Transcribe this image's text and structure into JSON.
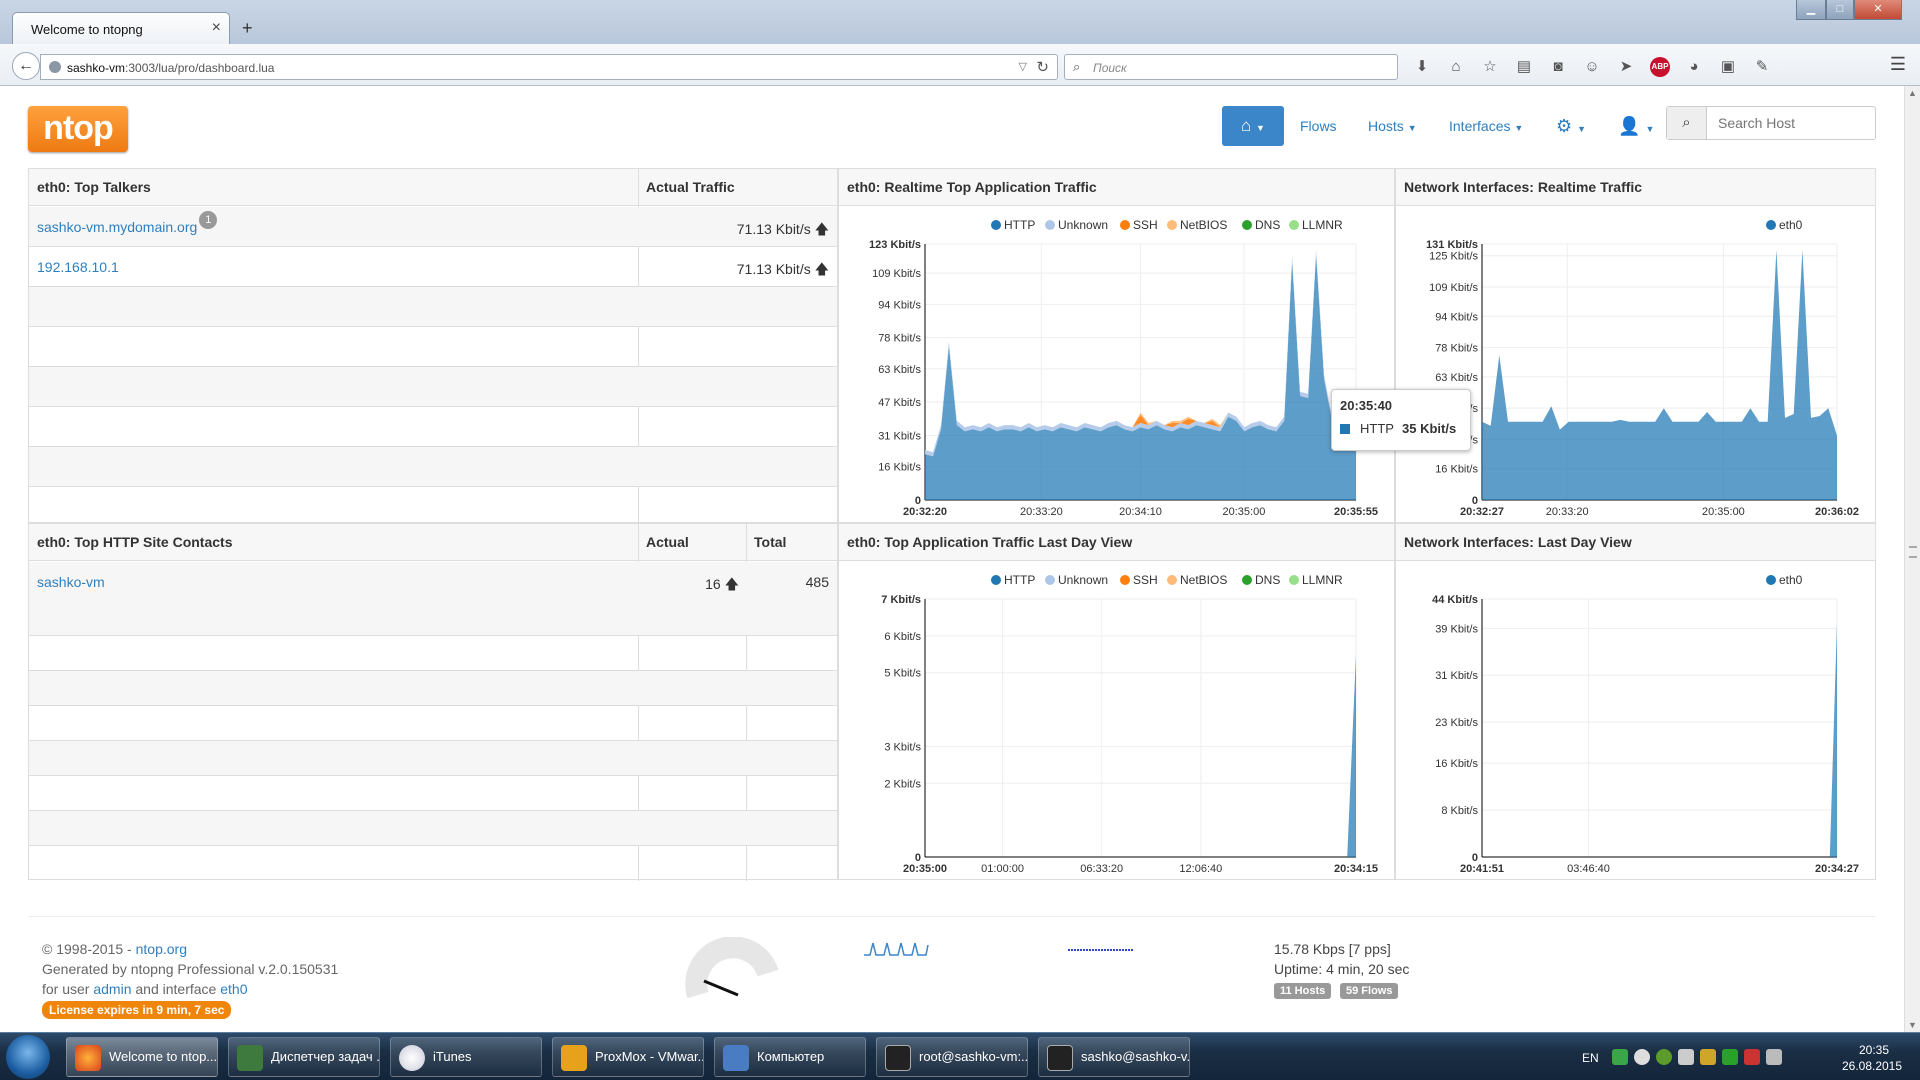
{
  "browser": {
    "tab_title": "Welcome to ntopng",
    "url_host": "sashko-vm",
    "url_rest": ":3003/lua/pro/dashboard.lua",
    "search_placeholder": "Поиск",
    "abp_label": "ABP"
  },
  "app": {
    "logo": "ntop",
    "nav": {
      "flows": "Flows",
      "hosts": "Hosts",
      "interfaces": "Interfaces"
    },
    "search_host_placeholder": "Search Host"
  },
  "top_talkers": {
    "title": "eth0: Top Talkers",
    "col_traffic": "Actual Traffic",
    "rows": [
      {
        "host": "sashko-vm.mydomain.org",
        "badge": "1",
        "traffic": "71.13 Kbit/s"
      },
      {
        "host": "192.168.10.1",
        "badge": "",
        "traffic": "71.13 Kbit/s"
      }
    ]
  },
  "top_http": {
    "title": "eth0: Top HTTP Site Contacts",
    "col_actual": "Actual",
    "col_total": "Total",
    "rows": [
      {
        "site": "sashko-vm",
        "actual": "16",
        "total": "485"
      }
    ]
  },
  "panels": {
    "app_realtime": "eth0: Realtime Top Application Traffic",
    "if_realtime": "Network Interfaces: Realtime Traffic",
    "app_lastday": "eth0: Top Application Traffic Last Day View",
    "if_lastday": "Network Interfaces: Last Day View"
  },
  "tooltip": {
    "time": "20:35:40",
    "series": "HTTP",
    "value": "35 Kbit/s"
  },
  "chart_data": [
    {
      "type": "area",
      "legend": [
        "HTTP",
        "Unknown",
        "SSH",
        "NetBIOS",
        "DNS",
        "LLMNR"
      ],
      "colors": [
        "#1f77b4",
        "#aec7e8",
        "#ff7f0e",
        "#ffbb78",
        "#2ca02c",
        "#98df8a"
      ],
      "yticks": [
        "0",
        "16 Kbit/s",
        "31 Kbit/s",
        "47 Kbit/s",
        "63 Kbit/s",
        "78 Kbit/s",
        "94 Kbit/s",
        "109 Kbit/s",
        "123 Kbit/s"
      ],
      "ytick_values": [
        0,
        16,
        31,
        47,
        63,
        78,
        94,
        109,
        123
      ],
      "xticks": [
        "20:32:20",
        "20:33:20",
        "20:34:10",
        "20:35:00",
        "20:35:55"
      ],
      "xtick_pos": [
        0,
        0.27,
        0.5,
        0.74,
        1
      ],
      "ylim": [
        0,
        123
      ],
      "series": [
        {
          "name": "HTTP",
          "values": [
            22,
            21,
            34,
            74,
            36,
            33,
            34,
            33,
            35,
            33,
            34,
            34,
            33,
            35,
            33,
            34,
            33,
            35,
            34,
            33,
            35,
            34,
            33,
            35,
            36,
            34,
            33,
            35,
            34,
            36,
            34,
            33,
            35,
            34,
            36,
            35,
            34,
            33,
            40,
            38,
            33,
            35,
            36,
            34,
            33,
            38,
            115,
            50,
            49,
            118,
            58,
            38,
            33,
            33,
            32
          ]
        },
        {
          "name": "Unknown",
          "values": [
            2,
            2,
            2,
            2,
            2,
            2,
            2,
            2,
            2,
            2,
            2,
            2,
            2,
            2,
            2,
            2,
            2,
            2,
            2,
            2,
            2,
            2,
            2,
            2,
            2,
            2,
            2,
            2,
            2,
            2,
            2,
            2,
            2,
            2,
            2,
            2,
            2,
            2,
            2,
            2,
            2,
            2,
            2,
            2,
            2,
            2,
            2,
            2,
            2,
            2,
            2,
            2,
            2,
            2,
            2
          ]
        },
        {
          "name": "SSH",
          "values": [
            0,
            0,
            0,
            0,
            0,
            0,
            0,
            0,
            0,
            0,
            0,
            0,
            0,
            0,
            0,
            0,
            0,
            0,
            0,
            0,
            0,
            0,
            0,
            0,
            0,
            0,
            0,
            4,
            0,
            0,
            0,
            2,
            0,
            3,
            0,
            0,
            2,
            0,
            0,
            0,
            0,
            0,
            0,
            0,
            0,
            0,
            0,
            0,
            0,
            0,
            0,
            0,
            0,
            0,
            0
          ]
        },
        {
          "name": "NetBIOS",
          "values": [
            0,
            0,
            0,
            0,
            0,
            0,
            0,
            0,
            0,
            0,
            0,
            0,
            0,
            0,
            0,
            0,
            0,
            0,
            0,
            0,
            0,
            0,
            0,
            0,
            0,
            0,
            0,
            1,
            1,
            0,
            0,
            1,
            1,
            1,
            0,
            0,
            1,
            1,
            0,
            0,
            0,
            0,
            0,
            0,
            0,
            0,
            0,
            0,
            0,
            0,
            0,
            0,
            0,
            0,
            0
          ]
        },
        {
          "name": "DNS",
          "values": []
        },
        {
          "name": "LLMNR",
          "values": []
        }
      ]
    },
    {
      "type": "area",
      "legend": [
        "eth0"
      ],
      "colors": [
        "#1f77b4"
      ],
      "yticks": [
        "0",
        "16 Kbit/s",
        "31 Kbit/s",
        "47 Kbit/s",
        "63 Kbit/s",
        "78 Kbit/s",
        "94 Kbit/s",
        "109 Kbit/s",
        "125 Kbit/s",
        "131 Kbit/s"
      ],
      "ytick_values": [
        0,
        16,
        31,
        47,
        63,
        78,
        94,
        109,
        125,
        131
      ],
      "xticks": [
        "20:32:27",
        "20:33:20",
        "20:35:00",
        "20:36:02"
      ],
      "xtick_pos": [
        0,
        0.24,
        0.68,
        1
      ],
      "ylim": [
        0,
        131
      ],
      "series": [
        {
          "name": "eth0",
          "values": [
            40,
            38,
            74,
            40,
            40,
            40,
            40,
            40,
            48,
            36,
            40,
            40,
            40,
            40,
            40,
            40,
            41,
            40,
            40,
            40,
            40,
            47,
            40,
            40,
            40,
            40,
            45,
            40,
            40,
            40,
            40,
            47,
            40,
            40,
            128,
            42,
            44,
            128,
            42,
            43,
            47,
            33
          ]
        }
      ]
    },
    {
      "type": "area",
      "legend": [
        "HTTP",
        "Unknown",
        "SSH",
        "NetBIOS",
        "DNS",
        "LLMNR"
      ],
      "colors": [
        "#1f77b4",
        "#aec7e8",
        "#ff7f0e",
        "#ffbb78",
        "#2ca02c",
        "#98df8a"
      ],
      "yticks": [
        "0",
        "2 Kbit/s",
        "3 Kbit/s",
        "5 Kbit/s",
        "6 Kbit/s",
        "7 Kbit/s"
      ],
      "ytick_values": [
        0,
        2,
        3,
        5,
        6,
        7
      ],
      "xticks": [
        "20:35:00",
        "01:00:00",
        "06:33:20",
        "12:06:40",
        "20:34:15"
      ],
      "xtick_pos": [
        0,
        0.18,
        0.41,
        0.64,
        1
      ],
      "ylim": [
        0,
        7
      ],
      "series": [
        {
          "name": "HTTP",
          "values": [
            0,
            0,
            0,
            0,
            0,
            0,
            0,
            0,
            0,
            0,
            0,
            0,
            0,
            0,
            0,
            0,
            0,
            0,
            0,
            0,
            0,
            0,
            0,
            0,
            0,
            0,
            0,
            0,
            0,
            0,
            0,
            0,
            0,
            0,
            0,
            0,
            0,
            0,
            0,
            0,
            0,
            0,
            0,
            0,
            0,
            0,
            0,
            0,
            0,
            5.5
          ]
        }
      ]
    },
    {
      "type": "area",
      "legend": [
        "eth0"
      ],
      "colors": [
        "#1f77b4"
      ],
      "yticks": [
        "0",
        "8 Kbit/s",
        "16 Kbit/s",
        "23 Kbit/s",
        "31 Kbit/s",
        "39 Kbit/s",
        "44 Kbit/s"
      ],
      "ytick_values": [
        0,
        8,
        16,
        23,
        31,
        39,
        44
      ],
      "xticks": [
        "20:41:51",
        "03:46:40",
        "20:34:27"
      ],
      "xtick_pos": [
        0,
        0.3,
        1
      ],
      "ylim": [
        0,
        44
      ],
      "series": [
        {
          "name": "eth0",
          "values": [
            0,
            0,
            0,
            0,
            0,
            0,
            0,
            0,
            0,
            0,
            0,
            0,
            0,
            0,
            0,
            0,
            0,
            0,
            0,
            0,
            0,
            0,
            0,
            0,
            0,
            0,
            0,
            0,
            0,
            0,
            0,
            0,
            0,
            0,
            0,
            0,
            0,
            0,
            0,
            0,
            0,
            0,
            0,
            0,
            0,
            0,
            0,
            0,
            0,
            40
          ]
        }
      ]
    }
  ],
  "footer": {
    "copyright_pre": "© 1998-2015 - ",
    "copyright_link": "ntop.org",
    "generated": "Generated by ntopng Professional v.2.0.150531",
    "for_user_pre": "for user ",
    "user": "admin",
    "and_iface": " and interface ",
    "iface": "eth0",
    "license": "License expires in 9 min, 7 sec",
    "rate": "15.78 Kbps [7 pps]",
    "uptime": "Uptime: 4 min, 20 sec",
    "hosts_label": "11 Hosts",
    "flows_label": "59 Flows"
  },
  "taskbar": {
    "tasks": [
      "Welcome to ntop...",
      "Диспетчер задач ...",
      "iTunes",
      "ProxMox - VMwar...",
      "Компьютер",
      "root@sashko-vm:...",
      "sashko@sashko-v..."
    ],
    "lang": "EN",
    "time": "20:35",
    "date": "26.08.2015"
  }
}
